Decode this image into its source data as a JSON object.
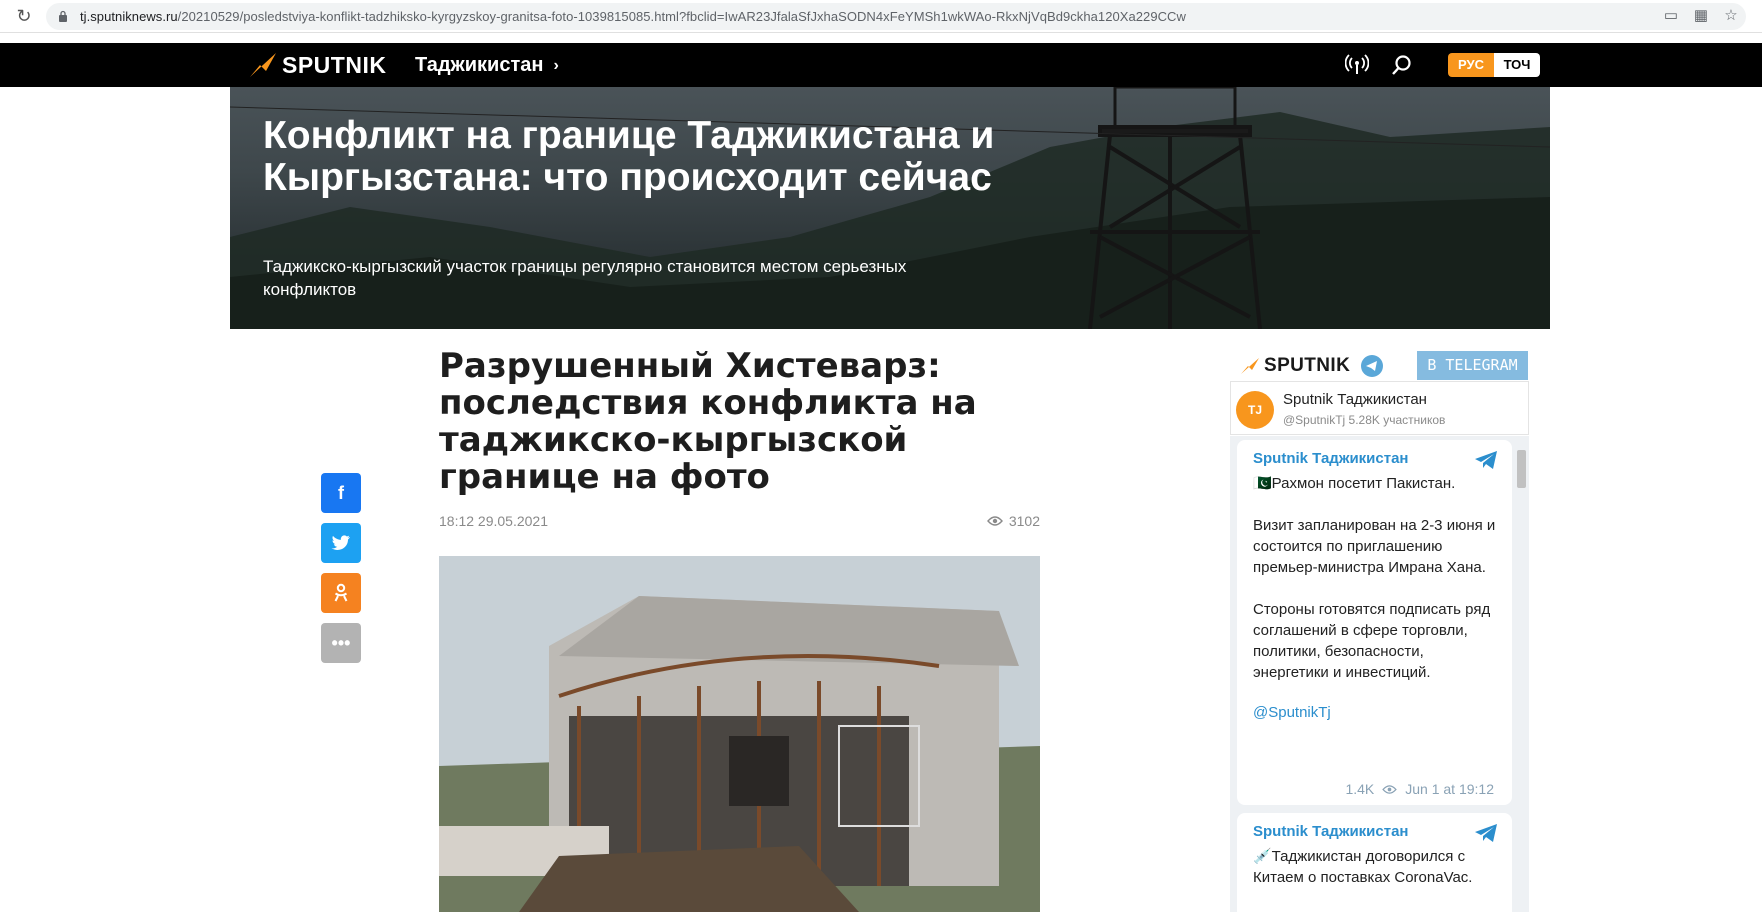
{
  "browser": {
    "url_main": "tj.sputniknews.ru",
    "url_path": "/20210529/posledstviya-konflikt-tadzhiksko-kyrgyzskoy-granitsa-foto-1039815085.html?fbclid=IwAR23JfalaSfJxhaSODN4xFeYMSh1wkWAo-RkxNjVqBd9ckha120Xa229CCw"
  },
  "header": {
    "logo_text": "SPUTNIK",
    "region": "Таджикистан",
    "lang_active": "РУС",
    "lang_other": "ТОЧ"
  },
  "hero": {
    "title": "Конфликт на границе Таджикистана и Кыргызстана: что происходит сейчас",
    "subtitle": "Таджикско-кыргызский участок границы регулярно становится местом серьезных конфликтов"
  },
  "article": {
    "title": "Разрушенный Хистеварз: последствия конфликта на таджикско-кыргызской границе на фото",
    "datetime": "18:12 29.05.2021",
    "views": "3102"
  },
  "colors": {
    "brand_orange": "#f8961d",
    "facebook": "#1877f2",
    "twitter": "#1da1f2",
    "odnoklassniki": "#f58220",
    "more": "#b3b3b3",
    "telegram_blue": "#2b8ecd"
  },
  "telegram": {
    "brand": "SPUTNIK",
    "tag": "В TELEGRAM",
    "channel_name": "Sputnik Таджикистан",
    "channel_sub": "@SputnikTj 5.28K участников",
    "avatar_text": "TJ",
    "posts": [
      {
        "author": "Sputnik Таджикистан",
        "text": "🇵🇰Рахмон посетит Пакистан.\n\nВизит запланирован на 2-3 июня и состоится по приглашению премьер-министра Имрана Хана.\n\nСтороны готовятся подписать ряд соглашений в сфере торговли, политики, безопасности, энергетики и инвестиций.\n\n",
        "link": "@SputnikTj",
        "views": "1.4K",
        "time": "Jun 1 at 19:12"
      },
      {
        "author": "Sputnik Таджикистан",
        "text": "💉Таджикистан договорился с Китаем о поставках CoronaVac."
      }
    ]
  }
}
